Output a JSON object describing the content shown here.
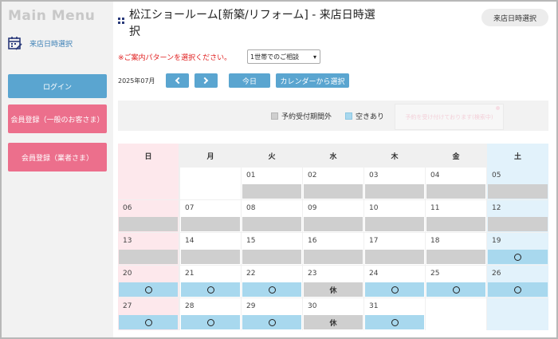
{
  "sidebar": {
    "title": "Main Menu",
    "link": {
      "label": "来店日時選択"
    },
    "buttons": [
      {
        "label": "ログイン"
      },
      {
        "label": "会員登録（一般のお客さま）"
      },
      {
        "label": "会員登録（業者さま）"
      }
    ]
  },
  "header": {
    "title": "松江ショールーム[新築/リフォーム] - 来店日時選択",
    "top_button": "来店日時選択"
  },
  "pattern": {
    "label": "※ご案内パターンを選択ください。",
    "selected": "1世帯でのご相談"
  },
  "nav": {
    "month": "2025年07月",
    "today": "今日",
    "calendar_select": "カレンダーから選択"
  },
  "legend": {
    "closed": "予約受付期間外",
    "available": "空きあり",
    "faded_text": "予約を受け付けております(検索中)"
  },
  "colors": {
    "accent_blue": "#5aa5d0",
    "accent_pink": "#ec6f8c",
    "closed": "#cfcfcf",
    "available": "#a8d8ee",
    "sunday_bg": "#fde8ec",
    "saturday_bg": "#e2f2fb"
  },
  "calendar": {
    "weekdays": [
      "日",
      "月",
      "火",
      "水",
      "木",
      "金",
      "土"
    ],
    "holiday_label": "休",
    "weeks": [
      [
        null,
        null,
        {
          "day": "01",
          "status": "closed"
        },
        {
          "day": "02",
          "status": "closed"
        },
        {
          "day": "03",
          "status": "closed"
        },
        {
          "day": "04",
          "status": "closed"
        },
        {
          "day": "05",
          "status": "closed"
        }
      ],
      [
        {
          "day": "06",
          "status": "closed"
        },
        {
          "day": "07",
          "status": "closed"
        },
        {
          "day": "08",
          "status": "closed"
        },
        {
          "day": "09",
          "status": "closed"
        },
        {
          "day": "10",
          "status": "closed"
        },
        {
          "day": "11",
          "status": "closed"
        },
        {
          "day": "12",
          "status": "closed"
        }
      ],
      [
        {
          "day": "13",
          "status": "closed"
        },
        {
          "day": "14",
          "status": "closed"
        },
        {
          "day": "15",
          "status": "closed"
        },
        {
          "day": "16",
          "status": "closed"
        },
        {
          "day": "17",
          "status": "closed"
        },
        {
          "day": "18",
          "status": "closed"
        },
        {
          "day": "19",
          "status": "available"
        }
      ],
      [
        {
          "day": "20",
          "status": "available"
        },
        {
          "day": "21",
          "status": "available"
        },
        {
          "day": "22",
          "status": "available"
        },
        {
          "day": "23",
          "status": "holiday"
        },
        {
          "day": "24",
          "status": "available"
        },
        {
          "day": "25",
          "status": "available"
        },
        {
          "day": "26",
          "status": "available"
        }
      ],
      [
        {
          "day": "27",
          "status": "available"
        },
        {
          "day": "28",
          "status": "available"
        },
        {
          "day": "29",
          "status": "available"
        },
        {
          "day": "30",
          "status": "holiday"
        },
        {
          "day": "31",
          "status": "available"
        },
        null,
        null
      ]
    ]
  }
}
